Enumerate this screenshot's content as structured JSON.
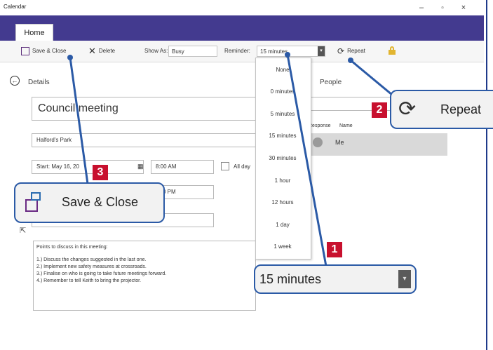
{
  "window": {
    "title": "Calendar",
    "minimize": "–",
    "maximize": "▫",
    "close": "×"
  },
  "tabs": {
    "home": "Home"
  },
  "ribbon": {
    "save_close": "Save & Close",
    "delete": "Delete",
    "show_as_label": "Show As:",
    "show_as_value": "Busy",
    "reminder_label": "Reminder:",
    "reminder_value": "15 minutes",
    "repeat": "Repeat"
  },
  "details": {
    "header": "Details",
    "subject": "Council meeting",
    "location": "Halford's Park",
    "start_label": "Start:",
    "start_date": "May 16, 20",
    "start_time": "8:00 AM",
    "all_day": "All day",
    "end_time_partial": "0 PM",
    "notes": [
      "Points to discuss in this meeting:",
      "",
      "1.) Discuss the changes suggested in the last one.",
      "2.) Implement new safety measures at crossroads.",
      "3.) Finalise on who is going to take future meetings forward.",
      "4.) Remember to tell Keith to bring the projector."
    ]
  },
  "reminder_options": [
    "None",
    "0 minutes",
    "5 minutes",
    "15 minutes",
    "30 minutes",
    "1 hour",
    "12 hours",
    "1 day",
    "1 week"
  ],
  "people": {
    "header": "People",
    "col_response": "Response",
    "col_name": "Name",
    "row_name": "Me"
  },
  "callouts": {
    "c1": {
      "number": "1",
      "text": "15 minutes"
    },
    "c2": {
      "number": "2",
      "text": "Repeat"
    },
    "c3": {
      "number": "3",
      "text": "Save & Close"
    }
  },
  "colors": {
    "tabbar": "#433a8f",
    "callout_border": "#2b5aa6",
    "badge": "#c8102e"
  }
}
